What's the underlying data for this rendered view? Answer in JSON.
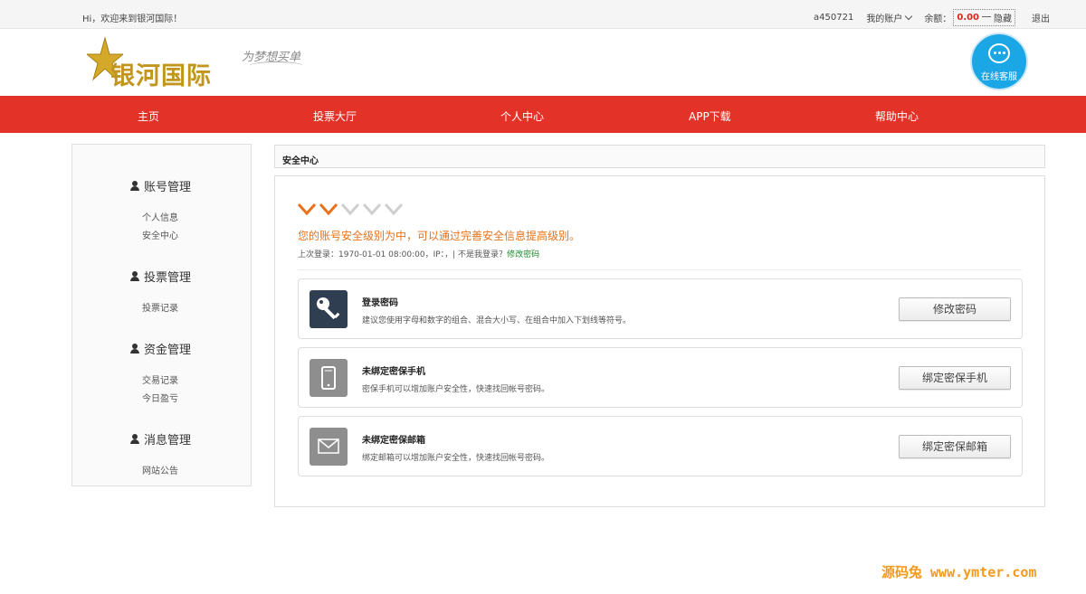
{
  "topbar": {
    "welcome": "Hi，欢迎来到银河国际！",
    "username": "a450721",
    "my_account": "我的账户",
    "balance_label": "余额：",
    "balance_value": "0.00",
    "hide_label": "隐藏",
    "logout": "退出"
  },
  "header": {
    "logo_text": "银河国际",
    "slogan": "为梦想买单",
    "service_label": "在线客服"
  },
  "nav": {
    "items": [
      "主页",
      "投票大厅",
      "个人中心",
      "APP下载",
      "帮助中心"
    ]
  },
  "sidebar": {
    "groups": [
      {
        "title": "账号管理",
        "links": [
          "个人信息",
          "安全中心"
        ]
      },
      {
        "title": "投票管理",
        "links": [
          "投票记录"
        ]
      },
      {
        "title": "资金管理",
        "links": [
          "交易记录",
          "今日盈亏"
        ]
      },
      {
        "title": "消息管理",
        "links": [
          "网站公告"
        ]
      }
    ]
  },
  "main": {
    "breadcrumb": "安全中心",
    "security_level_filled": 2,
    "security_level_total": 5,
    "level_text": "您的账号安全级别为中，可以通过完善安全信息提高级别。",
    "last_login_prefix": "上次登录：1970-01-01 08:00:00，IP：，| 不是我登录？",
    "last_login_link": "修改密码",
    "cards": [
      {
        "title": "登录密码",
        "desc": "建议您使用字母和数字的组合、混合大小写、在组合中加入下划线等符号。",
        "button": "修改密码",
        "icon": "key-icon",
        "icon_bg": "#2f3e50"
      },
      {
        "title": "未绑定密保手机",
        "desc": "密保手机可以增加账户安全性，快速找回帐号密码。",
        "button": "绑定密保手机",
        "icon": "phone-icon",
        "icon_bg": "#8e8e8e"
      },
      {
        "title": "未绑定密保邮箱",
        "desc": "绑定邮箱可以增加账户安全性，快速找回帐号密码。",
        "button": "绑定密保邮箱",
        "icon": "mail-icon",
        "icon_bg": "#8e8e8e"
      }
    ]
  },
  "watermark": "源码兔 www.ymter.com",
  "colors": {
    "nav_red": "#e33228",
    "level_orange": "#e8721b",
    "service_blue": "#1ba6e6"
  }
}
